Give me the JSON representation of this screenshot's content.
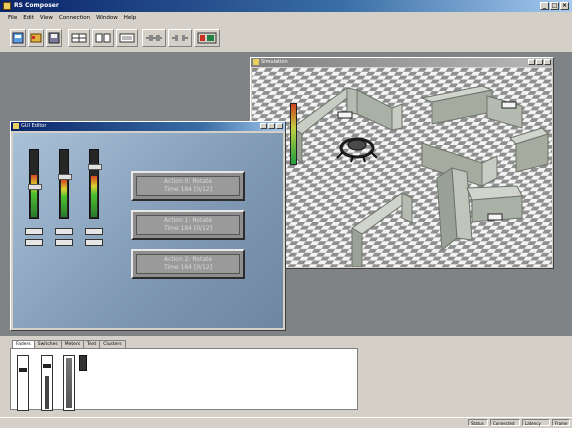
{
  "app": {
    "title": "RS Composer"
  },
  "menu": [
    "File",
    "Edit",
    "View",
    "Connection",
    "Window",
    "Help"
  ],
  "controller_window": {
    "title": "GUI Editor",
    "header_text": "",
    "meters": [
      {
        "level": 0.62,
        "thumb": 0.5,
        "label_top": "",
        "label_bottom": ""
      },
      {
        "level": 0.55,
        "thumb": 0.35,
        "label_top": "",
        "label_bottom": ""
      },
      {
        "level": 0.6,
        "thumb": 0.2,
        "label_top": "",
        "label_bottom": ""
      }
    ],
    "buttons": [
      {
        "line1": "Action 0: Rotate",
        "line2": "Time 184 [0/12]"
      },
      {
        "line1": "Action 1: Rotate",
        "line2": "Time 184 [0/12]"
      },
      {
        "line1": "Action 2: Rotate",
        "line2": "Time 184 [0/12]"
      }
    ]
  },
  "world_window": {
    "title": "Simulation",
    "tags": [
      "",
      "",
      "",
      ""
    ]
  },
  "bottom_tabs": [
    "Faders",
    "Switches",
    "Meters",
    "Text",
    "Clusters"
  ],
  "status": [
    "Status",
    "Connected",
    "Latency",
    "Frame"
  ]
}
